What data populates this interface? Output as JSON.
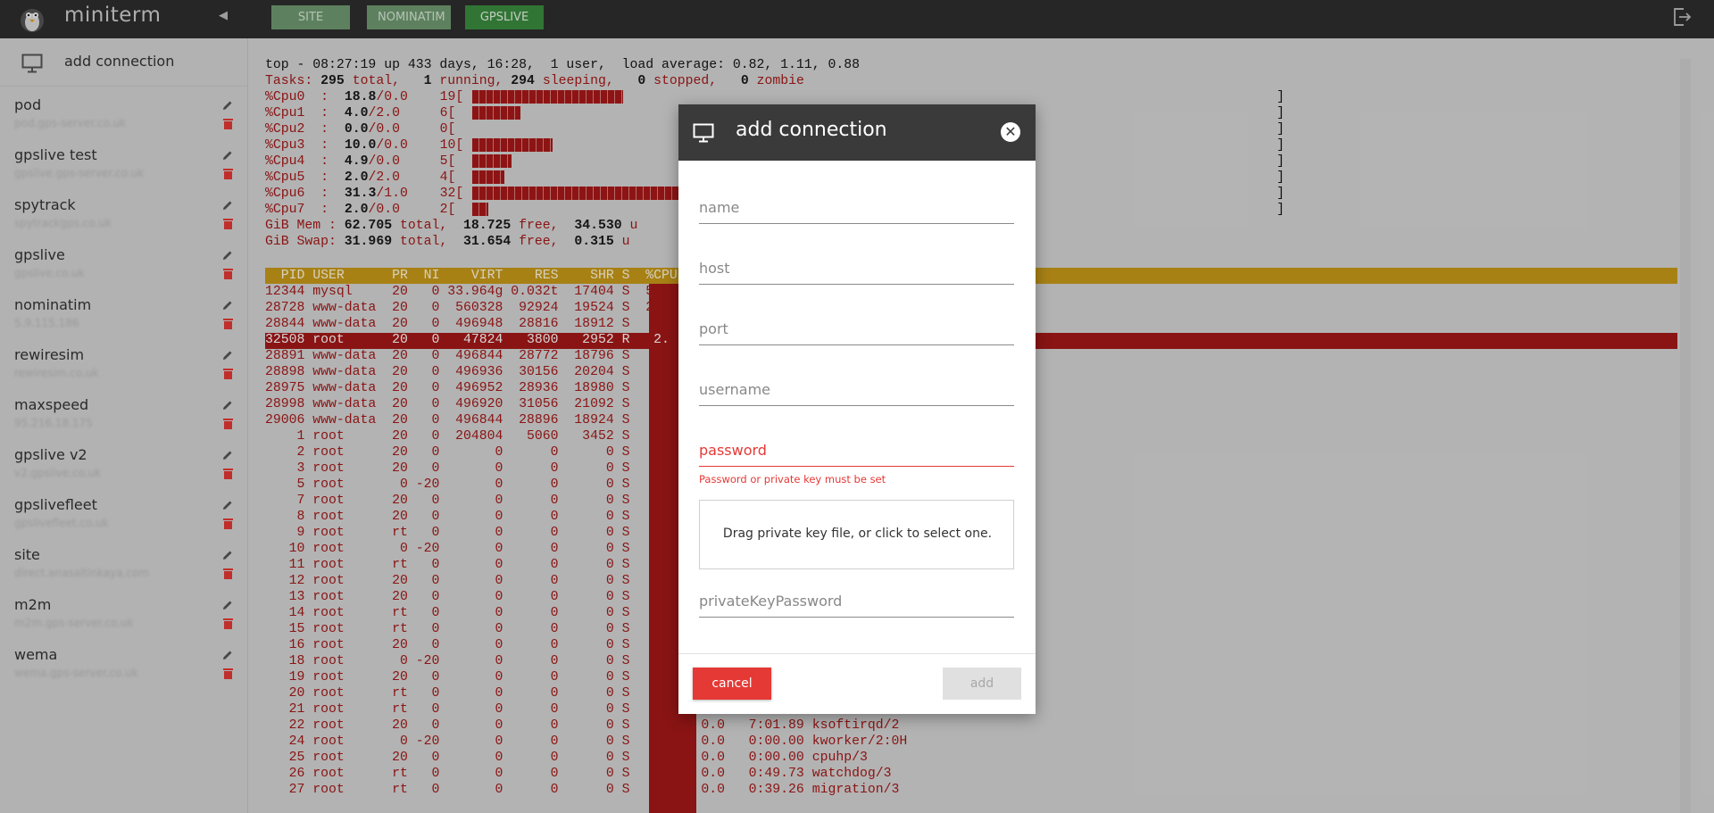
{
  "app": {
    "title": "miniterm"
  },
  "site_tabs": [
    {
      "label": "SITE",
      "active": false
    },
    {
      "label": "NOMINATIM",
      "active": false
    },
    {
      "label": "GPSLIVE",
      "active": true
    }
  ],
  "sidebar": {
    "add_connection": "add connection",
    "connections": [
      {
        "name": "pod",
        "host": "pod.gps-server.co.uk"
      },
      {
        "name": "gpslive test",
        "host": "gpslive.gps-server.co.uk"
      },
      {
        "name": "spytrack",
        "host": "spytrackgps.co.uk"
      },
      {
        "name": "gpslive",
        "host": "gpslive.co.uk"
      },
      {
        "name": "nominatim",
        "host": "5.9.115.186"
      },
      {
        "name": "rewiresim",
        "host": "rewiresim.co.uk"
      },
      {
        "name": "maxspeed",
        "host": "95.216.18.175"
      },
      {
        "name": "gpslive v2",
        "host": "v2.gpslive.co.uk"
      },
      {
        "name": "gpslivefleet",
        "host": "gpslivefleet.co.uk"
      },
      {
        "name": "site",
        "host": "direct.anasaltinkaya.com"
      },
      {
        "name": "m2m",
        "host": "m2m.gps-server.co.uk"
      },
      {
        "name": "wema",
        "host": "wema.gps-server.co.uk"
      }
    ]
  },
  "terminal": {
    "uptime_line": "top - 08:27:19 up 433 days, 16:28,  1 user,  load average: 0.82, 1.11, 0.88",
    "tasks": {
      "label": "Tasks:",
      "total": "295",
      "running": "1",
      "sleeping": "294",
      "stopped": "0",
      "zombie": "0"
    },
    "cpus": [
      {
        "name": "%Cpu0",
        "us": "18.8",
        "sy": "/0.0",
        "pct": "19",
        "fill": 0.188
      },
      {
        "name": "%Cpu1",
        "us": "4.0",
        "sy": "/2.0",
        "pct": "6",
        "fill": 0.06
      },
      {
        "name": "%Cpu2",
        "us": "0.0",
        "sy": "/0.0",
        "pct": "0",
        "fill": 0.0
      },
      {
        "name": "%Cpu3",
        "us": "10.0",
        "sy": "/0.0",
        "pct": "10",
        "fill": 0.1
      },
      {
        "name": "%Cpu4",
        "us": "4.9",
        "sy": "/0.0",
        "pct": "5",
        "fill": 0.049
      },
      {
        "name": "%Cpu5",
        "us": "2.0",
        "sy": "/2.0",
        "pct": "4",
        "fill": 0.04
      },
      {
        "name": "%Cpu6",
        "us": "31.3",
        "sy": "/1.0",
        "pct": "32",
        "fill": 0.323
      },
      {
        "name": "%Cpu7",
        "us": "2.0",
        "sy": "/0.0",
        "pct": "2",
        "fill": 0.02
      }
    ],
    "mem_line": [
      "GiB Mem : ",
      "62.705",
      " total,  ",
      "18.725",
      " free,  ",
      "34.530",
      " u"
    ],
    "swap_line": [
      "GiB Swap: ",
      "31.969",
      " total,  ",
      "31.654",
      " free,  ",
      "0.315",
      " u"
    ],
    "header": "  PID USER      PR  NI    VIRT    RES    SHR S  %CPU",
    "processes": [
      "12344 mysql     20   0 33.964g 0.032t  17404 S  54.",
      "28728 www-data  20   0  560328  92924  19524 S  23.",
      "28844 www-data  20   0  496948  28816  18912 S   2.",
      "32508 root      20   0   47824   3800   2952 R   2.",
      "28891 www-data  20   0  496844  28772  18796 S   1.",
      "28898 www-data  20   0  496936  30156  20204 S   1.",
      "28975 www-data  20   0  496952  28936  18980 S   1.",
      "28998 www-data  20   0  496920  31056  21092 S   1.",
      "29006 www-data  20   0  496844  28896  18924 S   1.",
      "    1 root      20   0  204804   5060   3452 S   0.",
      "    2 root      20   0       0      0      0 S   0.",
      "    3 root      20   0       0      0      0 S   0.",
      "    5 root       0 -20       0      0      0 S   0.",
      "    7 root      20   0       0      0      0 S   0.",
      "    8 root      20   0       0      0      0 S   0.",
      "    9 root      rt   0       0      0      0 S   0.",
      "   10 root       0 -20       0      0      0 S   0.",
      "   11 root      rt   0       0      0      0 S   0.",
      "   12 root      20   0       0      0      0 S   0.",
      "   13 root      20   0       0      0      0 S   0.",
      "   14 root      rt   0       0      0      0 S   0.",
      "   15 root      rt   0       0      0      0 S   0.",
      "   16 root      20   0       0      0      0 S   0.",
      "   18 root       0 -20       0      0      0 S   0.",
      "   19 root      20   0       0      0      0 S   0.",
      "   20 root      rt   0       0      0      0 S   0.",
      "   21 root      rt   0       0      0      0 S   0.",
      "   22 root      20   0       0      0      0 S   0.0   0.0   7:01.89 ksoftirqd/2",
      "   24 root       0 -20       0      0      0 S   0.0   0.0   0:00.00 kworker/2:0H",
      "   25 root      20   0       0      0      0 S   0.0   0.0   0:00.00 cpuhp/3",
      "   26 root      rt   0       0      0      0 S   0.0   0.0   0:49.73 watchdog/3",
      "   27 root      rt   0       0      0      0 S   0.0   0.0   0:39.26 migration/3"
    ]
  },
  "modal": {
    "title": "add connection",
    "fields": {
      "name": "name",
      "host": "host",
      "port": "port",
      "username": "username",
      "password": "password",
      "private_key_password": "privateKeyPassword"
    },
    "password_error": "Password or private key must be set",
    "dropzone": "Drag private key file, or click to select one.",
    "cancel": "cancel",
    "add": "add"
  }
}
